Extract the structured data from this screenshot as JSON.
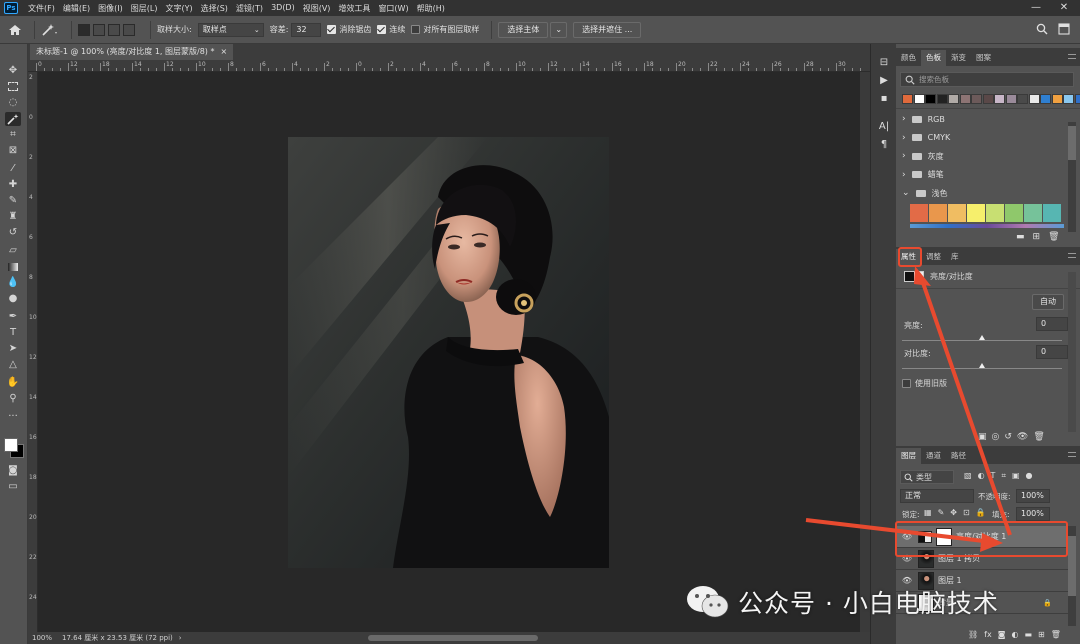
{
  "app": {
    "logo": "Ps"
  },
  "menubar": [
    "文件(F)",
    "编辑(E)",
    "图像(I)",
    "图层(L)",
    "文字(Y)",
    "选择(S)",
    "滤镜(T)",
    "3D(D)",
    "视图(V)",
    "增效工具",
    "窗口(W)",
    "帮助(H)"
  ],
  "options": {
    "sample_size_label": "取样大小:",
    "sample_size_value": "取样点",
    "tolerance_label": "容差:",
    "tolerance_value": "32",
    "antialias_label": "消除锯齿",
    "contiguous_label": "连续",
    "all_layers_label": "对所有图层取样",
    "select_subject": "选择主体",
    "select_mask": "选择并遮住 ..."
  },
  "document": {
    "tab_title": "未标题-1 @ 100% (亮度/对比度 1, 图层蒙版/8) *",
    "ruler_marks": [
      "0",
      "12",
      "18",
      "14",
      "12",
      "10",
      "8",
      "6",
      "4",
      "2",
      "0",
      "2",
      "4",
      "6",
      "8",
      "10",
      "12",
      "14",
      "16",
      "18",
      "20",
      "22",
      "24",
      "26",
      "28",
      "30"
    ],
    "vruler_marks": [
      "2",
      "0",
      "2",
      "4",
      "6",
      "8",
      "10",
      "12",
      "14",
      "16",
      "18",
      "20",
      "22",
      "24"
    ]
  },
  "status": {
    "zoom": "100%",
    "info": "17.64 厘米 x 23.53 厘米 (72 ppi)"
  },
  "swatches_panel": {
    "tabs": [
      "颜色",
      "色板",
      "渐变",
      "图案"
    ],
    "search_placeholder": "搜索色板",
    "recent": [
      "#e06a3c",
      "#ffffff",
      "#000000",
      "#222222",
      "#b0aaa6",
      "#8d7474",
      "#6c5a5a",
      "#5a4848",
      "#c8b6c8",
      "#9a8a9a",
      "#4a4a4a",
      "#e8e8e8",
      "#2f7fd0",
      "#f0a040",
      "#8ac8f0",
      "#3070c8"
    ],
    "folders": [
      "RGB",
      "CMYK",
      "灰度",
      "蜡笔",
      "浅色"
    ],
    "light_colors": [
      "#e26b47",
      "#e9974c",
      "#f0bd62",
      "#f6ef6c",
      "#c8df72",
      "#8fc86b",
      "#76c29a",
      "#57b6b2"
    ]
  },
  "properties_panel": {
    "tabs": [
      "属性",
      "调整",
      "库"
    ],
    "type_label": "亮度/对比度",
    "auto_button": "自动",
    "brightness_label": "亮度:",
    "brightness_value": "0",
    "contrast_label": "对比度:",
    "contrast_value": "0",
    "legacy_label": "使用旧版"
  },
  "layers_panel": {
    "tabs": [
      "图层",
      "通道",
      "路径"
    ],
    "filter_label": "类型",
    "blend_mode": "正常",
    "opacity_label": "不透明度:",
    "opacity_value": "100%",
    "lock_label": "锁定:",
    "fill_label": "填充:",
    "fill_value": "100%",
    "layers": [
      "亮度/对比度 1",
      "图层 1 拷贝",
      "图层 1",
      "背景"
    ]
  },
  "watermark": {
    "text": "公众号 · 小白电脑技术"
  },
  "colors": {
    "accent": "#e84a2f"
  }
}
